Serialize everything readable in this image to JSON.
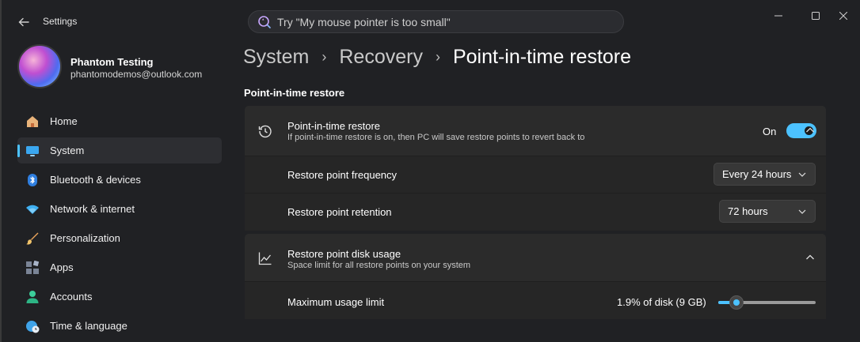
{
  "window": {
    "title": "Settings"
  },
  "search": {
    "placeholder": "Try \"My mouse pointer is too small\""
  },
  "profile": {
    "name": "Phantom Testing",
    "email": "phantomodemos@outlook.com"
  },
  "sidebar": {
    "items": [
      {
        "label": "Home",
        "icon": "home-icon",
        "active": false
      },
      {
        "label": "System",
        "icon": "system-icon",
        "active": true
      },
      {
        "label": "Bluetooth & devices",
        "icon": "bluetooth-icon",
        "active": false
      },
      {
        "label": "Network & internet",
        "icon": "wifi-icon",
        "active": false
      },
      {
        "label": "Personalization",
        "icon": "brush-icon",
        "active": false
      },
      {
        "label": "Apps",
        "icon": "apps-icon",
        "active": false
      },
      {
        "label": "Accounts",
        "icon": "person-icon",
        "active": false
      },
      {
        "label": "Time & language",
        "icon": "globe-clock-icon",
        "active": false
      }
    ]
  },
  "breadcrumb": [
    "System",
    "Recovery",
    "Point-in-time restore"
  ],
  "section_title": "Point-in-time restore",
  "restore_card": {
    "title": "Point-in-time restore",
    "description": "If point-in-time restore is on, then PC will save restore points to revert back to",
    "toggle_label": "On",
    "toggle_on": true,
    "frequency": {
      "label": "Restore point frequency",
      "value": "Every 24 hours"
    },
    "retention": {
      "label": "Restore point retention",
      "value": "72 hours"
    }
  },
  "disk_card": {
    "title": "Restore point disk usage",
    "description": "Space limit for all restore points on your system",
    "limit": {
      "label": "Maximum usage limit",
      "value_text": "1.9% of disk (9 GB)",
      "fraction": 0.19
    }
  },
  "colors": {
    "accent": "#4cc2ff",
    "background": "#202124",
    "card": "#2b2b2b"
  }
}
